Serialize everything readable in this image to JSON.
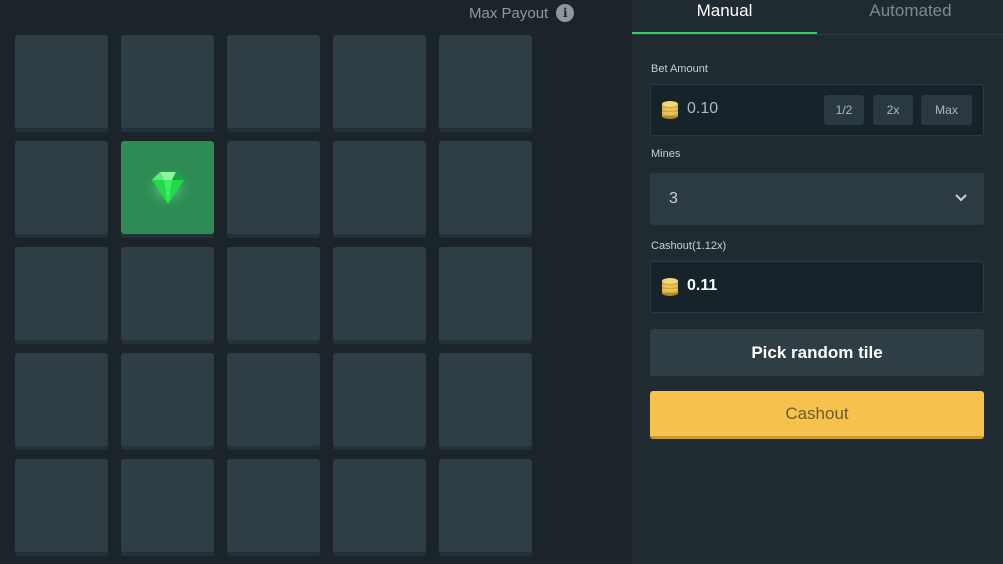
{
  "header": {
    "max_payout_label": "Max Payout",
    "info_icon": "info-icon"
  },
  "tabs": [
    {
      "label": "Manual",
      "active": true
    },
    {
      "label": "Automated",
      "active": false
    }
  ],
  "bet": {
    "label": "Bet Amount",
    "value": "0.10",
    "coin_icon": "coin-stack-icon",
    "half_label": "1/2",
    "double_label": "2x",
    "max_label": "Max"
  },
  "mines": {
    "label": "Mines",
    "value": "3",
    "icon": "chevron-down-icon"
  },
  "cashout_field": {
    "label": "Cashout(1.12x)",
    "value": "0.11",
    "coin_icon": "coin-stack-icon"
  },
  "buttons": {
    "pick_random": "Pick random tile",
    "cashout": "Cashout"
  },
  "grid": {
    "rows": 5,
    "cols": 5,
    "revealed": [
      {
        "row": 2,
        "col": 2,
        "content": "gem"
      }
    ]
  },
  "colors": {
    "accent_green": "#32d15f",
    "cashout_yellow": "#f6c14c",
    "tile": "#2f3d45",
    "gem_tile": "#2d8b53"
  }
}
